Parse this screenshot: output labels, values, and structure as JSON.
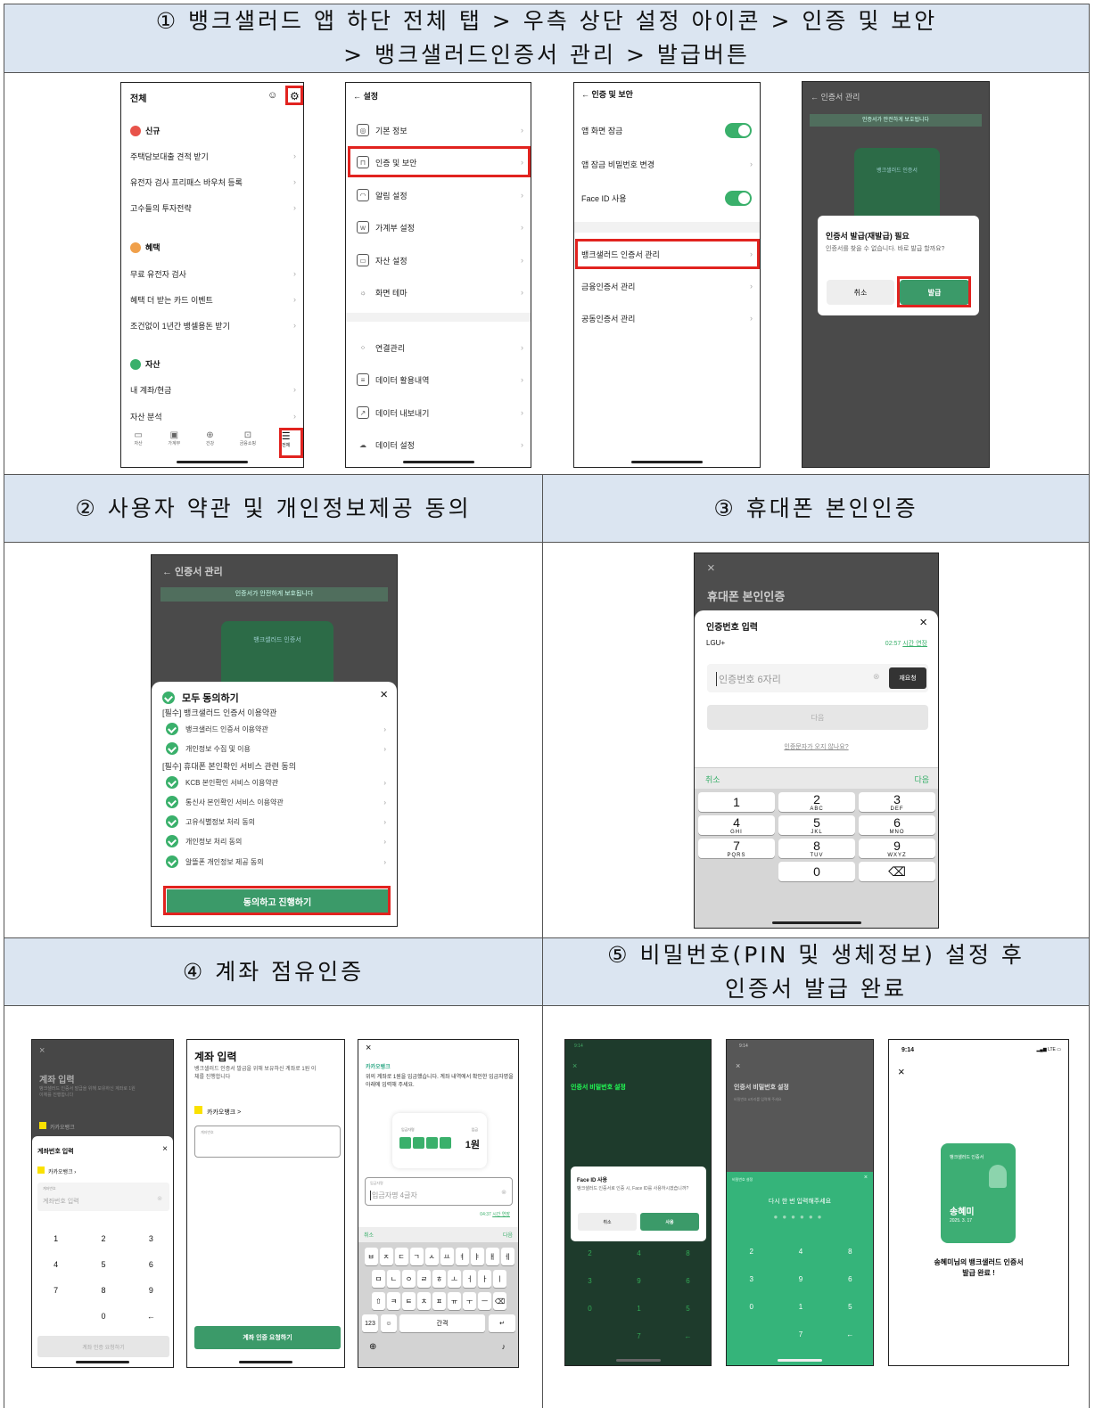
{
  "sections": {
    "s1_title_line1": "① 뱅크샐러드 앱 하단 전체 탭 > 우측 상단 설정 아이콘 > 인증 및 보안",
    "s1_title_line2": "> 뱅크샐러드인증서 관리 > 발급버튼",
    "s2_title": "② 사용자 약관 및 개인정보제공 동의",
    "s3_title": "③ 휴대폰 본인인증",
    "s4_title": "④ 계좌 점유인증",
    "s5_title_line1": "⑤ 비밀번호(PIN 및 생체정보) 설정 후",
    "s5_title_line2": "인증서 발급 완료"
  },
  "screen_all": {
    "title": "전체",
    "sec_new": "신규",
    "items_new": [
      "주택담보대출 견적 받기",
      "유전자 검사 프리패스 바우처 등록",
      "고수들의 투자전략"
    ],
    "sec_benefit": "혜택",
    "items_benefit": [
      "무료 유전자 검사",
      "혜택 더 받는 카드 이벤트",
      "조건없이 1년간 뱅셀용돈 받기"
    ],
    "sec_asset": "자산",
    "items_asset": [
      "내 계좌/현금",
      "자산 분석"
    ],
    "tabs": [
      "자산",
      "가계부",
      "건강",
      "금융쇼핑",
      "전체"
    ]
  },
  "screen_settings": {
    "title": "← 설정",
    "items": [
      "기본 정보",
      "인증 및 보안",
      "알림 설정",
      "가계부 설정",
      "자산 설정",
      "화면 테마"
    ],
    "items2": [
      "연결관리",
      "데이터 활용내역",
      "데이터 내보내기",
      "데이터 설정"
    ]
  },
  "screen_security": {
    "title": "← 인증 및 보안",
    "items": [
      "앱 화면 잠금",
      "앱 잠금 비밀번호 변경",
      "Face ID 사용"
    ],
    "items2": [
      "뱅크샐러드 인증서 관리",
      "금융인증서 관리",
      "공동인증서 관리"
    ]
  },
  "screen_issue": {
    "title": "← 인증서 관리",
    "banner": "인증서가 안전하게 보호됩니다",
    "card": "뱅크샐러드 인증서",
    "dialog_title": "인증서 발급(재발급) 필요",
    "dialog_body": "인증서를 찾을 수 없습니다. 바로 발급 할까요?",
    "cancel": "취소",
    "issue": "발급"
  },
  "screen_terms": {
    "title": "← 인증서 관리",
    "banner": "인증서가 안전하게 보호됩니다",
    "card": "뱅크샐러드 인증서",
    "agree_all": "모두 동의하기",
    "group1": "[필수] 뱅크샐러드 인증서 이용약관",
    "g1_items": [
      "뱅크샐러드 인증서 이용약관",
      "개인정보 수집 및 이용"
    ],
    "group2": "[필수] 휴대폰 본인확인 서비스 관련 동의",
    "g2_items": [
      "KCB 본인확인 서비스 이용약관",
      "통신사 본인확인 서비스 이용약관",
      "고유식별정보 처리 동의",
      "개인정보 처리 동의",
      "알뜰폰 개인정보 제공 동의"
    ],
    "button": "동의하고 진행하기"
  },
  "screen_phone": {
    "close": "×",
    "title": "휴대폰 본인인증",
    "sheet_title": "인증번호 입력",
    "carrier": "LGU+",
    "timer": "02:57",
    "extend": "시간 연장",
    "placeholder": "인증번호 6자리",
    "resend": "재요청",
    "next_btn": "다음",
    "no_sms": "인증문자가 오지 않나요?",
    "cancel": "취소",
    "next": "다음",
    "keys": [
      [
        "1",
        ""
      ],
      [
        "2",
        "ABC"
      ],
      [
        "3",
        "DEF"
      ],
      [
        "4",
        "GHI"
      ],
      [
        "5",
        "JKL"
      ],
      [
        "6",
        "MNO"
      ],
      [
        "7",
        "PQRS"
      ],
      [
        "8",
        "TUV"
      ],
      [
        "9",
        "WXYZ"
      ],
      [
        "",
        ""
      ],
      [
        "0",
        ""
      ],
      [
        "⌫",
        ""
      ]
    ]
  },
  "screen_acc1": {
    "title": "계좌 입력",
    "desc": "뱅크샐러드 인증서 발급을 위해 보유하신 계좌로 1원 이체를 진행합니다",
    "bank": "카카오뱅크",
    "sheet_title": "계좌번호 입력",
    "field_label": "계좌번호",
    "placeholder": "계좌번호 입력",
    "keys": [
      "1",
      "2",
      "3",
      "4",
      "5",
      "6",
      "7",
      "8",
      "9",
      "",
      "0",
      "←"
    ],
    "button": "계좌 인증 요청하기"
  },
  "screen_acc2": {
    "title": "계좌 입력",
    "desc": "뱅크샐러드 인증서 발급을 위해 보유하신 계좌로 1원 이체를 진행합니다",
    "bank": "카카오뱅크 >",
    "field_label": "계좌번호",
    "button": "계좌 인증 요청하기"
  },
  "screen_acc3": {
    "bank": "카카오뱅크",
    "desc": "위의 계좌로 1원을 입금했습니다. 계좌 내역에서 확인한 입금자명을 아래에 입력해 주세요.",
    "label_name": "입금자명",
    "label_amount": "입금",
    "amount": "1원",
    "field_label": "입금자명",
    "placeholder": "입금자명 4글자",
    "timer": "04:37",
    "extend": "시간 연장",
    "cancel": "취소",
    "next": "다음",
    "kb_row1": [
      "ㅂ",
      "ㅈ",
      "ㄷ",
      "ㄱ",
      "ㅅ",
      "ㅛ",
      "ㅕ",
      "ㅑ",
      "ㅐ",
      "ㅔ"
    ],
    "kb_row2": [
      "ㅁ",
      "ㄴ",
      "ㅇ",
      "ㄹ",
      "ㅎ",
      "ㅗ",
      "ㅓ",
      "ㅏ",
      "ㅣ"
    ],
    "kb_row3": [
      "⇧",
      "ㅋ",
      "ㅌ",
      "ㅊ",
      "ㅍ",
      "ㅠ",
      "ㅜ",
      "ㅡ",
      "⌫"
    ],
    "kb_123": "123",
    "kb_space": "간격",
    "kb_return": "↵"
  },
  "screen_pin1": {
    "time": "9:14",
    "title": "인증서 비밀번호 설정",
    "dialog_title": "Face ID 사용",
    "dialog_body": "뱅크샐러드 인증서로 인증 시, Face ID를 사용하시겠습니까?",
    "cancel": "취소",
    "use": "사용",
    "keys": [
      "2",
      "4",
      "8",
      "3",
      "9",
      "6",
      "0",
      "1",
      "5",
      "",
      "7",
      "←"
    ]
  },
  "screen_pin2": {
    "time": "9:14",
    "title": "인증서 비밀번호 설정",
    "desc": "비밀번호 6자리를 입력해 주세요",
    "sheet_label": "비밀번호 설정",
    "prompt": "다시 한 번 입력해주세요",
    "keys": [
      "2",
      "4",
      "8",
      "3",
      "9",
      "6",
      "0",
      "1",
      "5",
      "",
      "7",
      "←"
    ]
  },
  "screen_done": {
    "time": "9:14",
    "close": "×",
    "card_title": "뱅크샐러드 인증서",
    "name": "송혜미",
    "date": "2025. 3. 17",
    "msg1": "송혜미님의 뱅크샐러드 인증서",
    "msg2": "발급 완료 !"
  }
}
